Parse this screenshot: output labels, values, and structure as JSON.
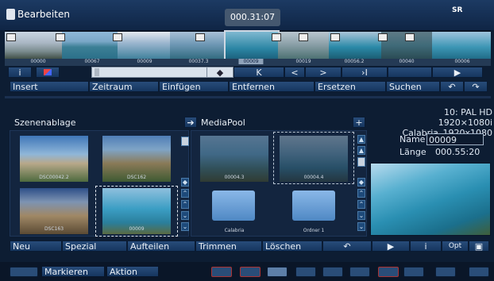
{
  "header": {
    "title": "Bearbeiten",
    "timecode": "000.31:07",
    "logo": "SR"
  },
  "filmstrip": {
    "labels": [
      "00000",
      "00067",
      "00009",
      "00037.3",
      "00009",
      "00019",
      "00056.2",
      "00040",
      "00006"
    ]
  },
  "controls": {
    "info": "i",
    "play": "▶",
    "step_back": "K",
    "prev": "<",
    "next": ">",
    "step_fwd": "›I",
    "play2": "▶"
  },
  "menu": {
    "insert": "Insert",
    "zeitraum": "Zeitraum",
    "einfuegen": "Einfügen",
    "entfernen": "Entfernen",
    "ersetzen": "Ersetzen",
    "suchen": "Suchen",
    "undo": "↶",
    "redo": "↷"
  },
  "project_info": {
    "line1": "10: PAL HD 1920×1080i",
    "line2": "Calabria_1920x1080"
  },
  "scenes": {
    "title": "Szenenablage",
    "clips": [
      "DSC00042.2",
      "DSC162",
      "DSC163",
      "00009"
    ]
  },
  "mediapool": {
    "title": "MediaPool",
    "items": [
      "00004.3",
      "00004.4",
      "Calabria",
      "Ordner 1"
    ]
  },
  "clip_details": {
    "name_label": "Name",
    "name_value": "00009",
    "length_label": "Länge",
    "length_value": "000.55:20"
  },
  "bottom_actions": {
    "neu": "Neu",
    "spezial": "Spezial",
    "aufteilen": "Aufteilen",
    "trimmen": "Trimmen",
    "loeschen": "Löschen",
    "revert": "↶",
    "play": "▶",
    "info": "i",
    "opt": "Opt"
  },
  "footer": {
    "markieren": "Markieren",
    "aktion": "Aktion"
  }
}
